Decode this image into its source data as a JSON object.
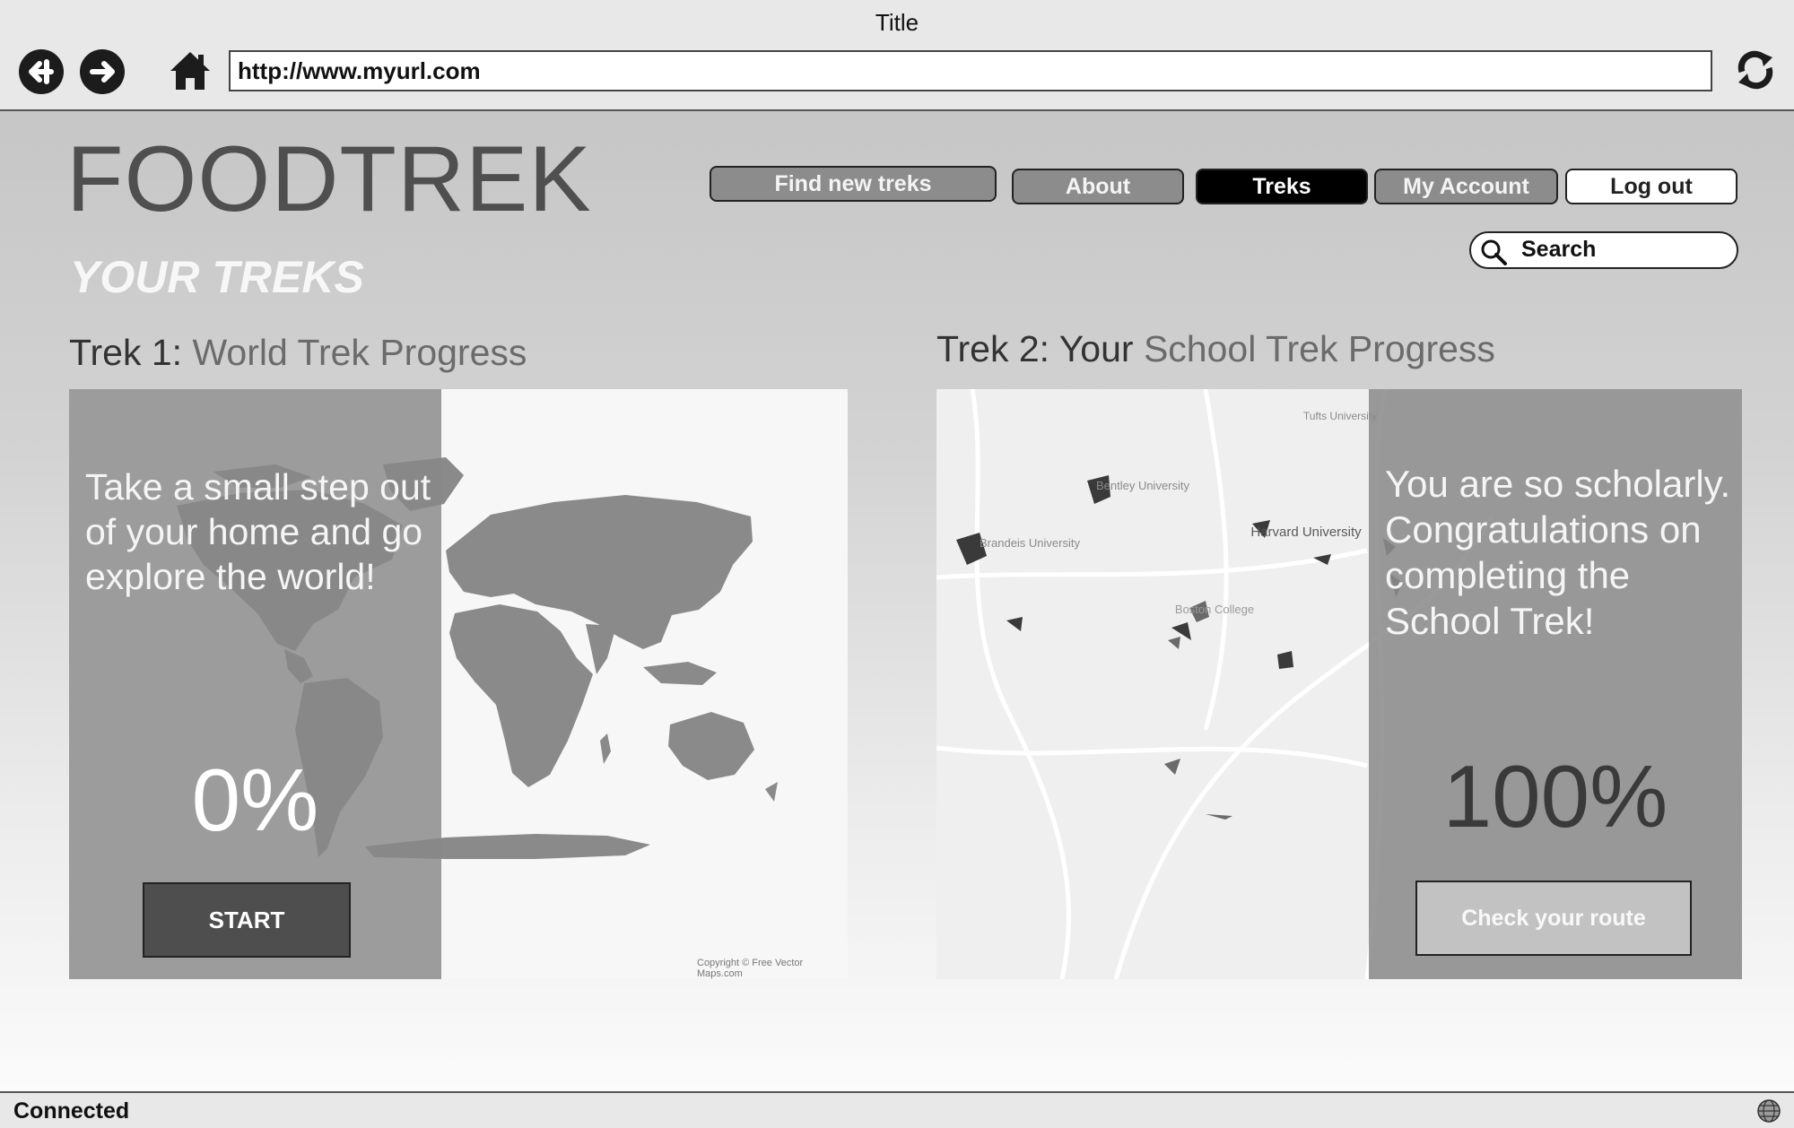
{
  "browser": {
    "title": "Title",
    "url": "http://www.myurl.com",
    "status": "Connected"
  },
  "site": {
    "logo": "FOODTREK",
    "section_title": "YOUR TREKS"
  },
  "nav": {
    "find": "Find new treks",
    "about": "About",
    "treks": "Treks",
    "account": "My Account",
    "logout": "Log out"
  },
  "search": {
    "label": "Search"
  },
  "trek1": {
    "heading_prefix": "Trek 1: ",
    "heading_name": "World Trek Progress",
    "message": "Take a small step out of your home and go explore the world!",
    "progress": "0%",
    "button": "START",
    "map_credit": "Copyright © Free Vector Maps.com"
  },
  "trek2": {
    "heading_prefix": "Trek 2: Your ",
    "heading_name": "School Trek Progress",
    "message": "You are so scholarly. Congratulations on completing the School Trek!",
    "progress": "100%",
    "button": "Check your route",
    "map_labels": {
      "tufts": "Tufts University",
      "bentley": "Bentley University",
      "brandeis": "Brandeis University",
      "harvard": "Harvard University",
      "bc": "Boston College"
    }
  },
  "icons": {
    "back": "arrow-left-circle",
    "forward": "arrow-right-circle",
    "home": "house",
    "refresh": "circular-arrows",
    "search": "magnifier",
    "status": "globe"
  }
}
